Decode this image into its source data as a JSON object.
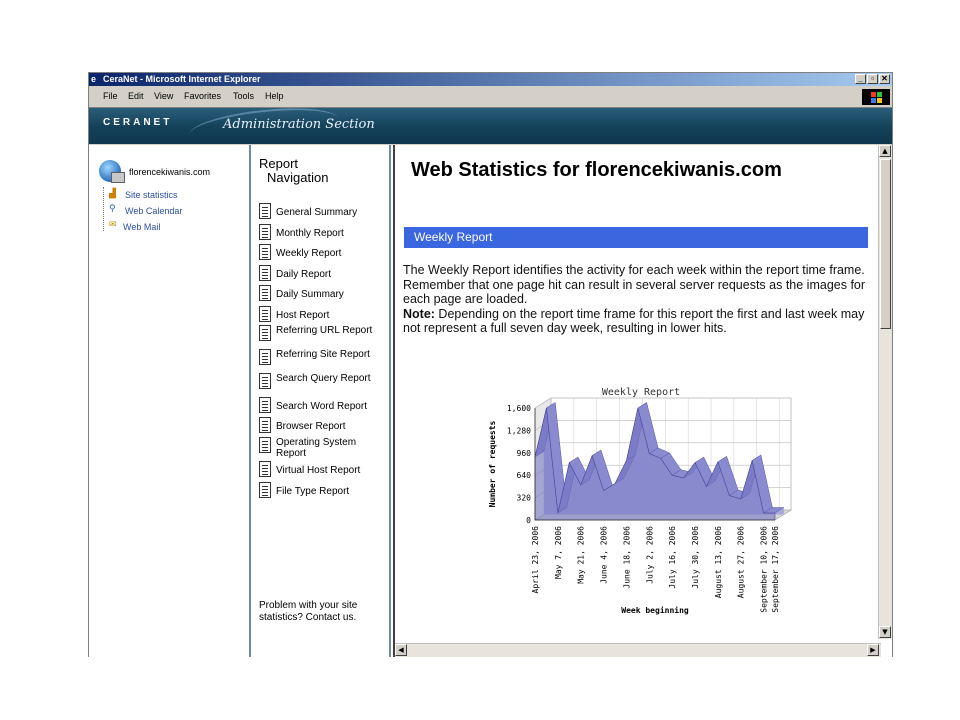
{
  "window": {
    "title": "CeraNet - Microsoft Internet Explorer",
    "buttons": [
      "_",
      "▫",
      "✕"
    ]
  },
  "menu": [
    "File",
    "Edit",
    "View",
    "Favorites",
    "Tools",
    "Help"
  ],
  "banner": {
    "logo": "CERANET",
    "section": "Administration Section"
  },
  "left": {
    "domain": "florencekiwanis.com",
    "links": [
      "Site statistics",
      "Web Calendar",
      "Web Mail"
    ]
  },
  "nav": {
    "heading_line1": "Report",
    "heading_line2": "Navigation",
    "items": [
      "General Summary",
      "Monthly Report",
      "Weekly Report",
      "Daily Report",
      "Daily Summary",
      "Host Report",
      "Referring URL Report",
      "Referring Site Report",
      "Search Query Report",
      "Search Word Report",
      "Browser Report",
      "Operating System Report",
      "Virtual Host Report",
      "File Type Report"
    ],
    "problem": "Problem with your site statistics? Contact us."
  },
  "main": {
    "title": "Web Statistics for florencekiwanis.com",
    "section_bar": "Weekly Report",
    "para1": "The Weekly Report identifies the activity for each week within the report time frame. Remember that one page hit can result in several server requests as the images for each page are loaded.",
    "note_label": "Note:",
    "para2": " Depending on the report time frame for this report the first and last week may not represent a full seven day week, resulting in lower hits."
  },
  "chart_data": {
    "type": "area",
    "title": "Weekly Report",
    "xlabel": "Week beginning",
    "ylabel": "Number of requests",
    "ylim": [
      0,
      1600
    ],
    "yticks": [
      0,
      320,
      640,
      960,
      1280,
      1600
    ],
    "ytick_labels": [
      "0",
      "320",
      "640",
      "960",
      "1,280",
      "1,600"
    ],
    "categories": [
      "April 23, 2006",
      "April 30, 2006",
      "May 7, 2006",
      "May 14, 2006",
      "May 21, 2006",
      "May 28, 2006",
      "June 4, 2006",
      "June 11, 2006",
      "June 18, 2006",
      "June 25, 2006",
      "July 2, 2006",
      "July 9, 2006",
      "July 16, 2006",
      "July 23, 2006",
      "July 30, 2006",
      "August 6, 2006",
      "August 13, 2006",
      "August 20, 2006",
      "August 27, 2006",
      "September 3, 2006",
      "September 10, 2006",
      "September 17, 2006"
    ],
    "xtick_labels": [
      "April 23, 2006",
      "May 7, 2006",
      "May 21, 2006",
      "June 4, 2006",
      "June 18, 2006",
      "July 2, 2006",
      "July 16, 2006",
      "July 30, 2006",
      "August 13, 2006",
      "August 27, 2006",
      "September 10, 2006",
      "September 17, 2006"
    ],
    "values": [
      900,
      1600,
      100,
      820,
      500,
      920,
      420,
      520,
      850,
      1600,
      950,
      880,
      640,
      600,
      820,
      480,
      830,
      350,
      300,
      850,
      100,
      100
    ],
    "color": "#8a8ad0",
    "grid": true
  }
}
